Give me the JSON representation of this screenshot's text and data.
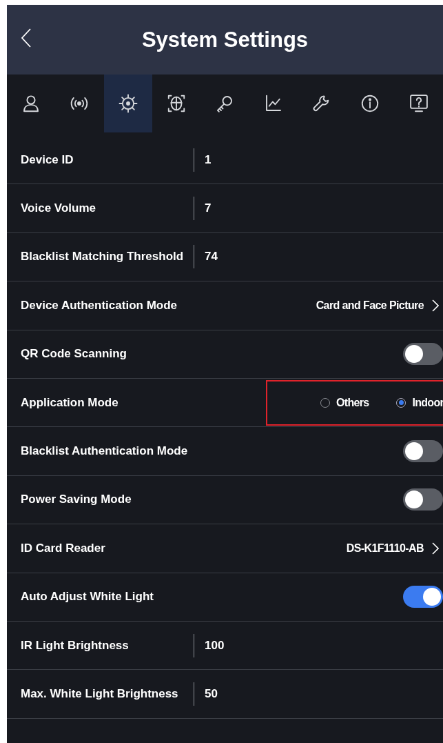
{
  "header": {
    "title": "System Settings"
  },
  "tabs": [
    {
      "selected": false
    },
    {
      "selected": false
    },
    {
      "selected": true
    },
    {
      "selected": false
    },
    {
      "selected": false
    },
    {
      "selected": false
    },
    {
      "selected": false
    },
    {
      "selected": false
    },
    {
      "selected": false
    }
  ],
  "settings": [
    {
      "kind": "value",
      "label": "Device ID",
      "value": "1"
    },
    {
      "kind": "value",
      "label": "Voice Volume",
      "value": "7"
    },
    {
      "kind": "value",
      "label": "Blacklist Matching Threshold",
      "value": "74"
    },
    {
      "kind": "select",
      "label": "Device Authentication Mode",
      "value": "Card and Face Picture"
    },
    {
      "kind": "toggle",
      "label": "QR Code Scanning",
      "on": false
    },
    {
      "kind": "radio",
      "label": "Application Mode",
      "highlighted": true,
      "options": [
        {
          "label": "Others",
          "selected": false
        },
        {
          "label": "Indoor",
          "selected": true
        }
      ]
    },
    {
      "kind": "toggle",
      "label": "Blacklist Authentication Mode",
      "on": false
    },
    {
      "kind": "toggle",
      "label": "Power Saving Mode",
      "on": false
    },
    {
      "kind": "select",
      "label": "ID Card Reader",
      "value": "DS-K1F1110-AB"
    },
    {
      "kind": "toggle",
      "label": "Auto Adjust White Light",
      "on": true
    },
    {
      "kind": "value",
      "label": "IR Light Brightness",
      "value": "100"
    },
    {
      "kind": "value",
      "label": "Max. White Light Brightness",
      "value": "50"
    }
  ]
}
